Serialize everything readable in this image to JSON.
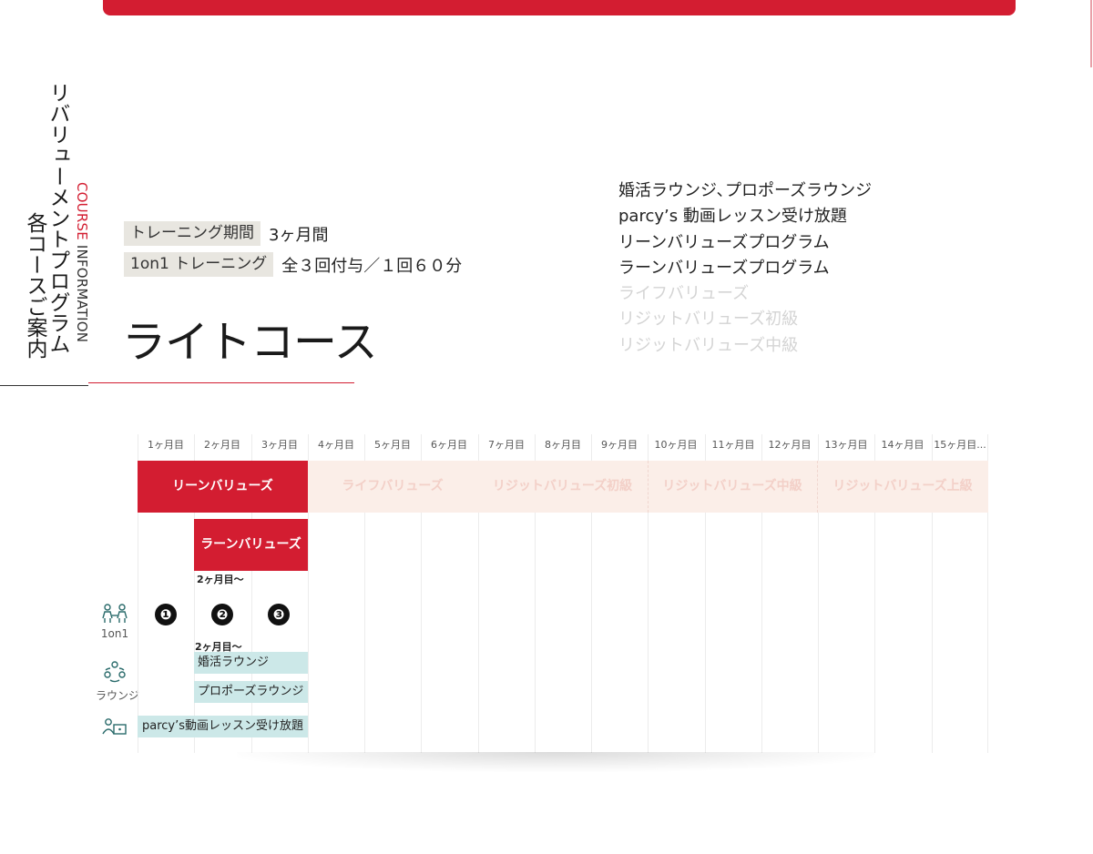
{
  "sidebar": {
    "title_line1": "リバリューメントプログラム",
    "title_line2": "各コースご案内",
    "course_word": "COURSE",
    "information_word": "INFORMATION"
  },
  "info": {
    "rows": [
      {
        "tag": "トレーニング期間",
        "value": "3ヶ月間"
      },
      {
        "tag": "1on1 トレーニング",
        "value": "全３回付与／１回６０分"
      }
    ]
  },
  "course": {
    "name": "ライトコース"
  },
  "features": {
    "included": [
      "婚活ラウンジ､プロポーズラウンジ",
      "parcy’s 動画レッスン受け放題",
      "リーンバリューズプログラム",
      "ラーンバリューズプログラム"
    ],
    "excluded": [
      "ライフバリューズ",
      "リジットバリューズ初級",
      "リジットバリューズ中級"
    ]
  },
  "schedule": {
    "months": [
      "1ヶ月目",
      "2ヶ月目",
      "3ヶ月目",
      "4ヶ月目",
      "5ヶ月目",
      "6ヶ月目",
      "7ヶ月目",
      "8ヶ月目",
      "9ヶ月目",
      "10ヶ月目",
      "11ヶ月目",
      "12ヶ月目",
      "13ヶ月目",
      "14ヶ月目",
      "15ヶ月目..."
    ],
    "programs": {
      "main": "リーンバリューズ",
      "faded": [
        "ライフバリューズ",
        "リジットバリューズ初級",
        "リジットバリューズ中級",
        "リジットバリューズ上級"
      ]
    },
    "learn_values": "ラーンバリューズ",
    "from_month2": "2ヶ月目〜",
    "sessions": [
      "❶",
      "❷",
      "❸"
    ],
    "lounges": [
      "婚活ラウンジ",
      "プロポーズラウンジ"
    ],
    "video_lessons": "parcy’s動画レッスン受け放題",
    "row_labels": {
      "one_on_one": "1on1",
      "lounge": "ラウンジ"
    }
  },
  "colors": {
    "accent": "#d31d31",
    "faded_bg": "#fbeee8",
    "lounge_bg": "#cce8e8"
  }
}
